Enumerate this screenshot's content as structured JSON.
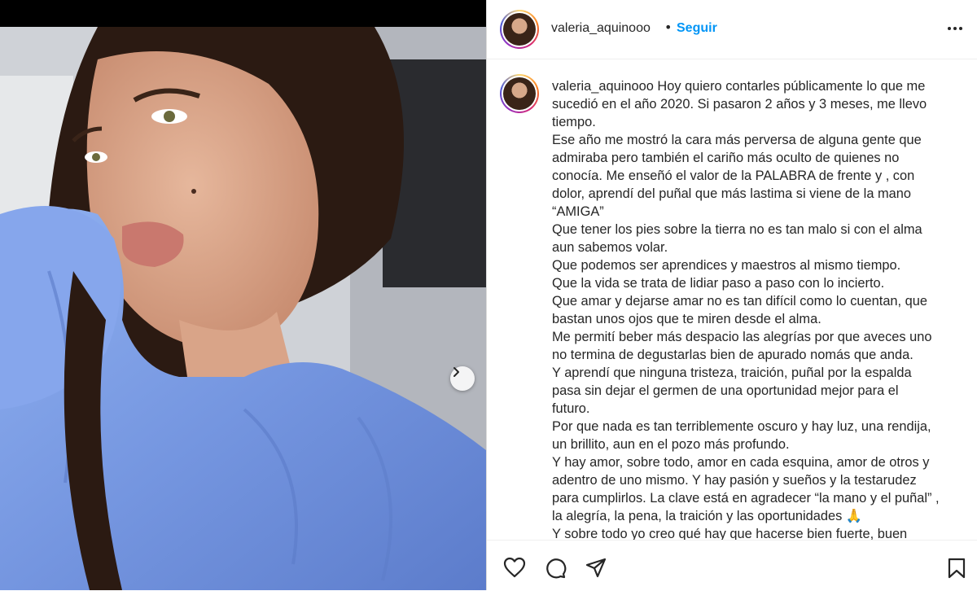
{
  "post": {
    "username": "valeria_aquinooo",
    "separator": "•",
    "follow_label": "Seguir"
  },
  "caption": {
    "username": "valeria_aquinooo",
    "lines": [
      " Hoy quiero contarles públicamente lo que me",
      "sucedió en el año 2020. Si pasaron 2 años y 3 meses, me llevo",
      "tiempo.",
      "Ese año me mostró la cara más perversa de alguna gente que",
      "admiraba pero también el cariño más oculto de quienes no",
      "conocía. Me enseñó el valor de la PALABRA de frente y , con",
      "dolor, aprendí del puñal que más lastima si viene de la mano",
      "“AMIGA”",
      "Que tener los pies sobre la tierra no es tan malo si con el alma",
      "aun sabemos volar.",
      "Que podemos ser aprendices y maestros al mismo tiempo.",
      "Que la vida se trata de lidiar paso a paso con lo incierto.",
      "Que amar y dejarse amar no es tan difícil como lo cuentan, que",
      "bastan unos ojos que te miren desde el alma.",
      "Me permití beber más despacio las alegrías por que aveces uno",
      "no termina de degustarlas bien de apurado nomás que anda.",
      "Y aprendí que ninguna tristeza, traición, puñal por la espalda",
      "pasa sin dejar el germen de una oportunidad mejor para el",
      "futuro.",
      "Por que nada es tan terriblemente oscuro y hay luz, una rendija,",
      "un brillito, aun en el pozo más profundo.",
      "Y hay amor, sobre todo, amor en cada esquina, amor de otros y",
      "adentro de uno mismo. Y hay pasión y sueños y la testarudez",
      "para cumplirlos. La clave está en agradecer “la mano y el puñal” ,",
      "la alegría, la pena, la traición y las oportunidades 🙏",
      "Y sobre todo yo creo qué hay que hacerse bien fuerte, buen"
    ]
  },
  "icons": {
    "like": "heart-icon",
    "comment": "comment-icon",
    "share": "share-icon",
    "save": "bookmark-icon",
    "next": "chevron-right-icon",
    "more": "more-options-icon"
  },
  "colors": {
    "accent": "#0095f6",
    "text": "#262626",
    "border": "#dbdbdb"
  }
}
